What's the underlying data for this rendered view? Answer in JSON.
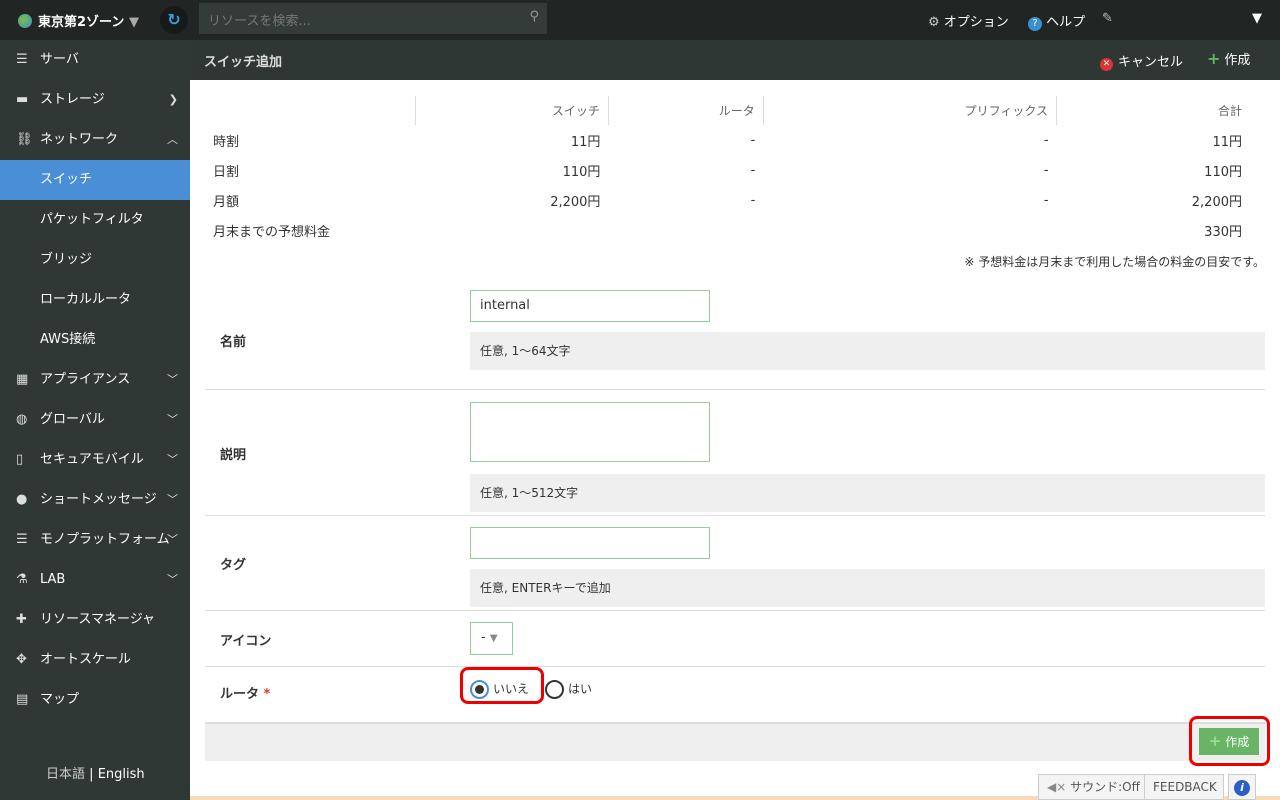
{
  "topbar": {
    "zone": "東京第2ゾーン",
    "search_placeholder": "リソースを検索...",
    "options": "オプション",
    "help": "ヘルプ"
  },
  "sidebar": {
    "items": [
      {
        "label": "サーバ",
        "icon": "server-icon"
      },
      {
        "label": "ストレージ",
        "icon": "storage-icon"
      },
      {
        "label": "ネットワーク",
        "icon": "network-icon"
      },
      {
        "label": "スイッチ",
        "active": true
      },
      {
        "label": "パケットフィルタ"
      },
      {
        "label": "ブリッジ"
      },
      {
        "label": "ローカルルータ"
      },
      {
        "label": "AWS接続"
      },
      {
        "label": "アプライアンス",
        "icon": "appliance-icon"
      },
      {
        "label": "グローバル",
        "icon": "globe-icon"
      },
      {
        "label": "セキュアモバイル",
        "icon": "mobile-icon"
      },
      {
        "label": "ショートメッセージ",
        "icon": "message-icon"
      },
      {
        "label": "モノプラットフォーム",
        "icon": "platform-icon"
      },
      {
        "label": "LAB",
        "icon": "flask-icon"
      },
      {
        "label": "リソースマネージャ",
        "icon": "puzzle-icon"
      },
      {
        "label": "オートスケール",
        "icon": "arrows-icon"
      },
      {
        "label": "マップ",
        "icon": "map-icon"
      }
    ],
    "lang_ja": "日本語",
    "lang_sep": "|",
    "lang_en": "English"
  },
  "header": {
    "title": "スイッチ追加",
    "cancel": "キャンセル",
    "create": "作成"
  },
  "pricing": {
    "columns": [
      "",
      "スイッチ",
      "ルータ",
      "プリフィックス",
      "合計"
    ],
    "rows": [
      [
        "時割",
        "11円",
        "-",
        "-",
        "11円"
      ],
      [
        "日割",
        "110円",
        "-",
        "-",
        "110円"
      ],
      [
        "月額",
        "2,200円",
        "-",
        "-",
        "2,200円"
      ],
      [
        "月末までの予想料金",
        "",
        "",
        "",
        "330円"
      ]
    ],
    "note": "※ 予想料金は月末まで利用した場合の料金の目安です。"
  },
  "form": {
    "name_label": "名前",
    "name_value": "internal",
    "name_hint": "任意, 1〜64文字",
    "desc_label": "説明",
    "desc_hint": "任意, 1〜512文字",
    "tag_label": "タグ",
    "tag_hint": "任意, ENTERキーで追加",
    "icon_label": "アイコン",
    "icon_value": "-",
    "router_label": "ルータ",
    "required": "*",
    "router_no": "いいえ",
    "router_yes": "はい",
    "router_selected": "いいえ",
    "create": "作成"
  },
  "footer": {
    "sound": "サウンド:Off",
    "feedback": "FEEDBACK"
  }
}
